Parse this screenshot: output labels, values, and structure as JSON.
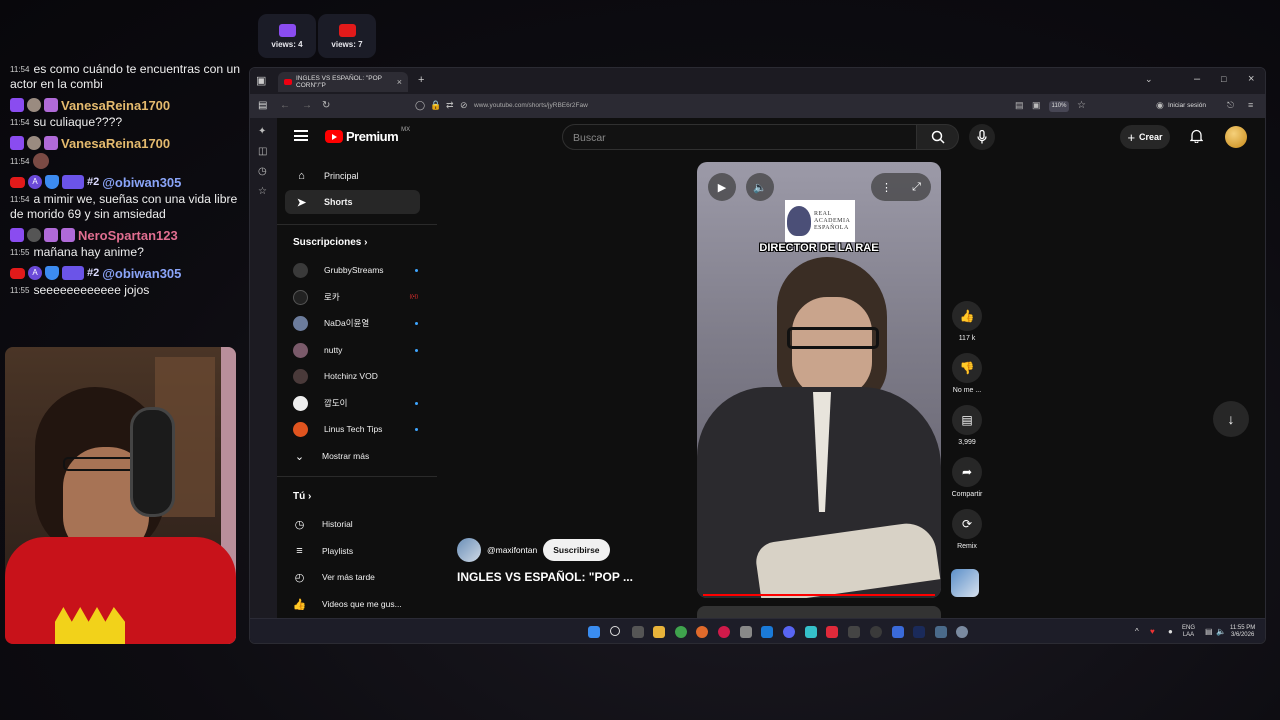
{
  "overlay": {
    "twitch_views": "views: 4",
    "youtube_views": "views: 7"
  },
  "chat": [
    {
      "time": "11:54",
      "user": "",
      "text": "es como cuándo te encuentras con un actor en la combi"
    },
    {
      "time": "11:54",
      "user": "VanesaReina1700",
      "text": "su culiaque????"
    },
    {
      "time": "11:54",
      "user": "VanesaReina1700",
      "text": ""
    },
    {
      "time": "11:54",
      "user": "@obiwan305",
      "rank": "#2",
      "text": "a mimir we, sueñas con una vida libre de morido 69 y sin amsiedad"
    },
    {
      "time": "11:55",
      "user": "NeroSpartan123",
      "text": "mañana hay anime?"
    },
    {
      "time": "11:55",
      "user": "@obiwan305",
      "rank": "#2",
      "text": "seeeeeeeeeeee jojos"
    }
  ],
  "browser": {
    "tab_title": "INGLES VS ESPAÑOL: \"POP CORN\"/\"P",
    "url": "www.youtube.com/shorts/jyRBE6r2Faw",
    "zoom": "110%",
    "signin": "Iniciar sesión"
  },
  "youtube": {
    "logo_text": "Premium",
    "region": "MX",
    "search_placeholder": "Buscar",
    "create_label": "Crear",
    "guide": {
      "home": "Principal",
      "shorts": "Shorts",
      "subscriptions_title": "Suscripciones",
      "subscriptions": [
        {
          "name": "GrubbyStreams",
          "status": "dot",
          "color": "#3a3a3a"
        },
        {
          "name": "로카",
          "status": "live",
          "color": "#222222"
        },
        {
          "name": "NaDa이윤열",
          "status": "dot",
          "color": "#6c7c9c"
        },
        {
          "name": "nutty",
          "status": "dot",
          "color": "#7a5a6a"
        },
        {
          "name": "Hotchinz VOD",
          "status": "",
          "color": "#4a3a3a"
        },
        {
          "name": "깝도이",
          "status": "dot",
          "color": "#eeeeee"
        },
        {
          "name": "Linus Tech Tips",
          "status": "dot",
          "color": "#e0541f"
        }
      ],
      "show_more": "Mostrar más",
      "you_title": "Tú",
      "history": "Historial",
      "playlists": "Playlists",
      "watch_later": "Ver más tarde",
      "liked": "Videos que me gus..."
    },
    "short": {
      "rae_line1": "REAL",
      "rae_line2": "ACADEMIA",
      "rae_line3": "ESPAÑOLA",
      "caption": "DIRECTOR DE LA RAE",
      "channel": "@maxifontan",
      "subscribe": "Suscribirse",
      "title": "INGLES VS ESPAÑOL: \"POP ...",
      "likes": "117 k",
      "dislike": "No me ...",
      "comments": "3,999",
      "share": "Compartir",
      "remix": "Remix"
    }
  },
  "taskbar": {
    "lang1": "ENG",
    "lang2": "LAA",
    "time": "11:55 PM",
    "date": "3/6/2026"
  },
  "colors": {
    "twitch": "#8a4cf0",
    "youtube_red": "#ff0000",
    "background": "#0f0f0f"
  }
}
